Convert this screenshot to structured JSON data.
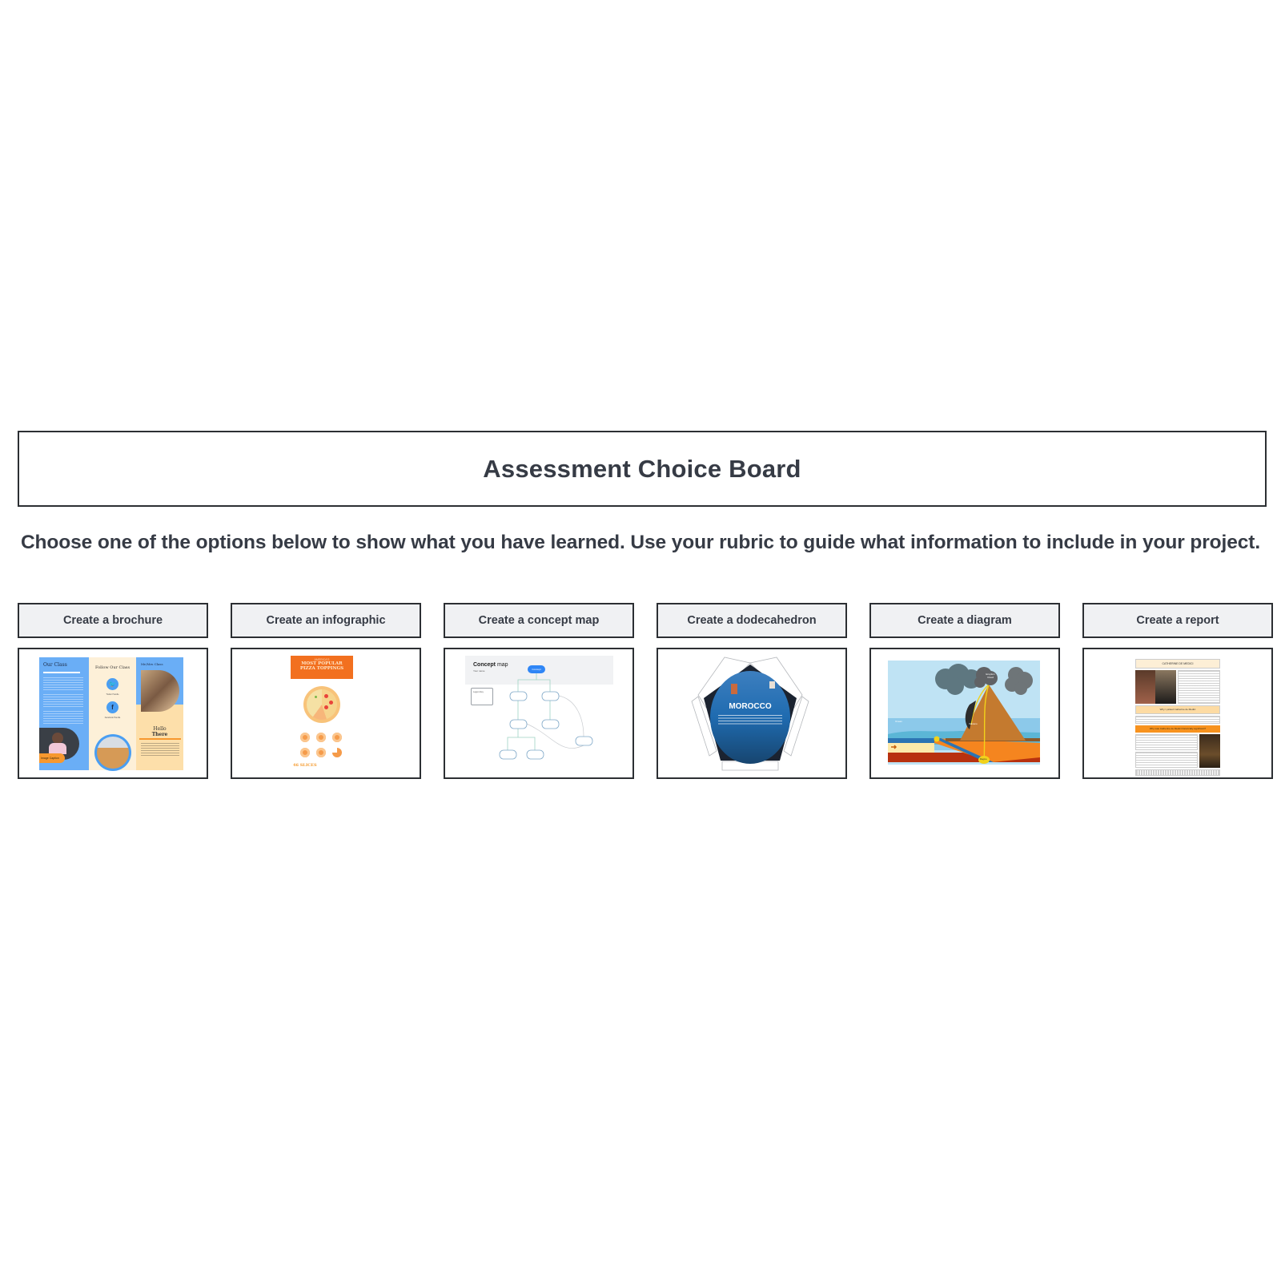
{
  "page": {
    "title": "Assessment Choice Board",
    "instructions": "Choose one of the options below to show what you have learned. Use your rubric to guide what information to include in your project."
  },
  "colors": {
    "text": "#363b45",
    "border": "#2c2f33",
    "header_bg": "#f0f1f3"
  },
  "options": [
    {
      "label": "Create a brochure",
      "thumbnail": {
        "kind": "brochure",
        "heading_left": "Our Class",
        "heading_mid": "Follow Our Class",
        "heading_right": "Mr/Mrs Class",
        "hello": "Hello",
        "there": "There",
        "caption": "Image Caption",
        "twitter_label": "Twitter Handle",
        "facebook_label": "Facebook Handle"
      }
    },
    {
      "label": "Create an infographic",
      "thumbnail": {
        "kind": "infographic",
        "kicker": "AMERICA'S",
        "title_line1": "MOST POPULAR",
        "title_line2": "PIZZA TOPPINGS",
        "footer_number": "46 SLICES"
      }
    },
    {
      "label": "Create a concept map",
      "thumbnail": {
        "kind": "concept-map",
        "title_bold": "Concept",
        "title_rest": " map",
        "name_label": "Your name",
        "root_node": "Concept",
        "legend_title": "Legend key"
      }
    },
    {
      "label": "Create a dodecahedron",
      "thumbnail": {
        "kind": "dodecahedron",
        "title": "MOROCCO"
      }
    },
    {
      "label": "Create a diagram",
      "thumbnail": {
        "kind": "volcano-diagram",
        "cloud_label_1": "Eruption",
        "cloud_label_2": "Cloud",
        "volcano_label": "Volcano",
        "ocean_label": "Ocean",
        "magma_label": "Magma"
      }
    },
    {
      "label": "Create a report",
      "thumbnail": {
        "kind": "report",
        "title": "CATHERINE DE MEDICI",
        "section1": "Why I picked Catherine de Medici",
        "section2": "Why was Catherine de Medici historically significant?"
      }
    }
  ]
}
